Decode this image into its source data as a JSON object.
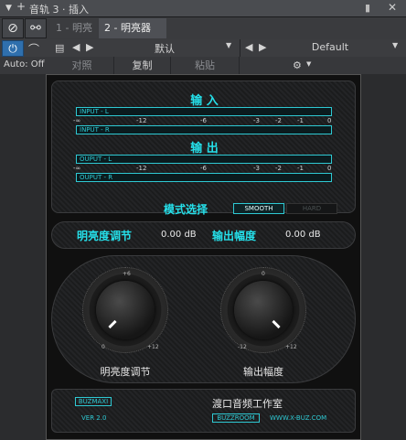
{
  "title_bar": {
    "title": "音轨 3 · 插入"
  },
  "tabs": [
    {
      "label": "1 - 明亮"
    },
    {
      "label": "2 - 明亮器"
    }
  ],
  "preset_row": {
    "preset_a": "默认",
    "preset_b": "Default"
  },
  "edit_row": {
    "auto_label": "Auto: Off",
    "compare": "对照",
    "copy": "复制",
    "paste": "粘贴"
  },
  "plugin": {
    "input_title": "输 入",
    "output_title": "输 出",
    "input_meters": [
      "INPUT - L",
      "INPUT - R"
    ],
    "output_meters": [
      "OUPUT - L",
      "OUPUT - R"
    ],
    "scale_ticks": [
      "-∞",
      "-12",
      "-6",
      "-3",
      "-2",
      "-1",
      "0"
    ],
    "mode_label": "模式选择",
    "mode_smooth": "SMOOTH",
    "mode_hard": "HARD",
    "brightness_label": "明亮度调节",
    "brightness_value": "0.00 dB",
    "output_level_label": "输出幅度",
    "output_level_value": "0.00 dB",
    "knob1": {
      "min": "0",
      "mid": "+6",
      "max": "+12",
      "label": "明亮度调节"
    },
    "knob2": {
      "min": "-12",
      "mid": "0",
      "max": "+12",
      "label": "输出幅度"
    },
    "brand": "BUZMAXI",
    "version": "VER 2.0",
    "company": "渡口音频工作室",
    "company_tag": "BUZZROOM",
    "url": "WWW.X-BUZ.COM"
  },
  "colors": {
    "accent_cyan": "#25e0ea",
    "active_blue": "#2f6fad"
  }
}
